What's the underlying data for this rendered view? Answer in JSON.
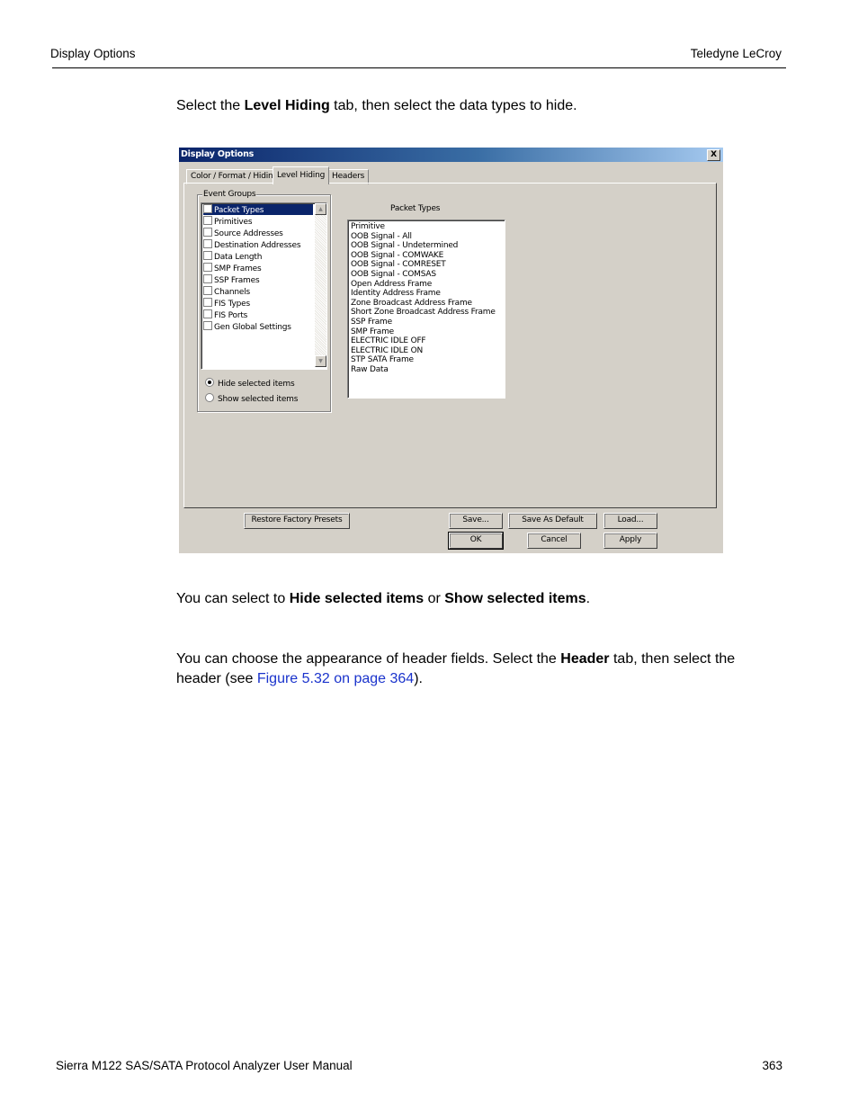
{
  "page_header": {
    "section": "Display Options",
    "brand": "Teledyne LeCroy"
  },
  "intro": {
    "pre": "Select the ",
    "bold": "Level Hiding",
    "post": " tab, then select the data types to hide."
  },
  "dialog": {
    "title": "Display Options",
    "close_label": "X",
    "tabs": [
      {
        "label": "Color / Format / Hiding",
        "active": false
      },
      {
        "label": "Level Hiding",
        "active": true
      },
      {
        "label": "Headers",
        "active": false
      }
    ],
    "event_groups": {
      "label": "Event Groups",
      "items": [
        {
          "label": "Packet Types",
          "checked": false,
          "selected": true
        },
        {
          "label": "Primitives",
          "checked": false,
          "selected": false
        },
        {
          "label": "Source Addresses",
          "checked": false,
          "selected": false
        },
        {
          "label": "Destination Addresses",
          "checked": false,
          "selected": false
        },
        {
          "label": "Data Length",
          "checked": false,
          "selected": false
        },
        {
          "label": "SMP Frames",
          "checked": false,
          "selected": false
        },
        {
          "label": "SSP Frames",
          "checked": false,
          "selected": false
        },
        {
          "label": "Channels",
          "checked": false,
          "selected": false
        },
        {
          "label": "FIS Types",
          "checked": false,
          "selected": false
        },
        {
          "label": "FIS Ports",
          "checked": false,
          "selected": false
        },
        {
          "label": "Gen Global Settings",
          "checked": false,
          "selected": false
        }
      ],
      "radio": [
        {
          "label": "Hide selected items",
          "checked": true
        },
        {
          "label": "Show selected items",
          "checked": false
        }
      ]
    },
    "packet_types": {
      "label": "Packet Types",
      "items": [
        "Primitive",
        "OOB Signal - All",
        "OOB Signal - Undetermined",
        "OOB Signal - COMWAKE",
        "OOB Signal - COMRESET",
        "OOB Signal - COMSAS",
        "Open Address Frame",
        "Identity Address Frame",
        "Zone Broadcast Address Frame",
        "Short Zone Broadcast Address Frame",
        "SSP Frame",
        "SMP Frame",
        "ELECTRIC IDLE OFF",
        "ELECTRIC IDLE ON",
        "STP SATA Frame",
        "Raw Data"
      ]
    },
    "buttons": {
      "restore": "Restore Factory Presets",
      "save": "Save...",
      "save_default": "Save As Default",
      "load": "Load...",
      "ok": "OK",
      "cancel": "Cancel",
      "apply": "Apply"
    }
  },
  "para2": {
    "pre": "You can select to ",
    "b1": "Hide selected items",
    "mid": " or ",
    "b2": "Show selected items",
    "post": "."
  },
  "para3": {
    "pre": "You can choose the appearance of header fields. Select the ",
    "bold": "Header",
    "mid": " tab, then select the header (see ",
    "link": "Figure 5.32 on page 364",
    "post": ")."
  },
  "page_footer": {
    "title": "Sierra M122 SAS/SATA Protocol Analyzer User Manual",
    "page_number": "363"
  }
}
